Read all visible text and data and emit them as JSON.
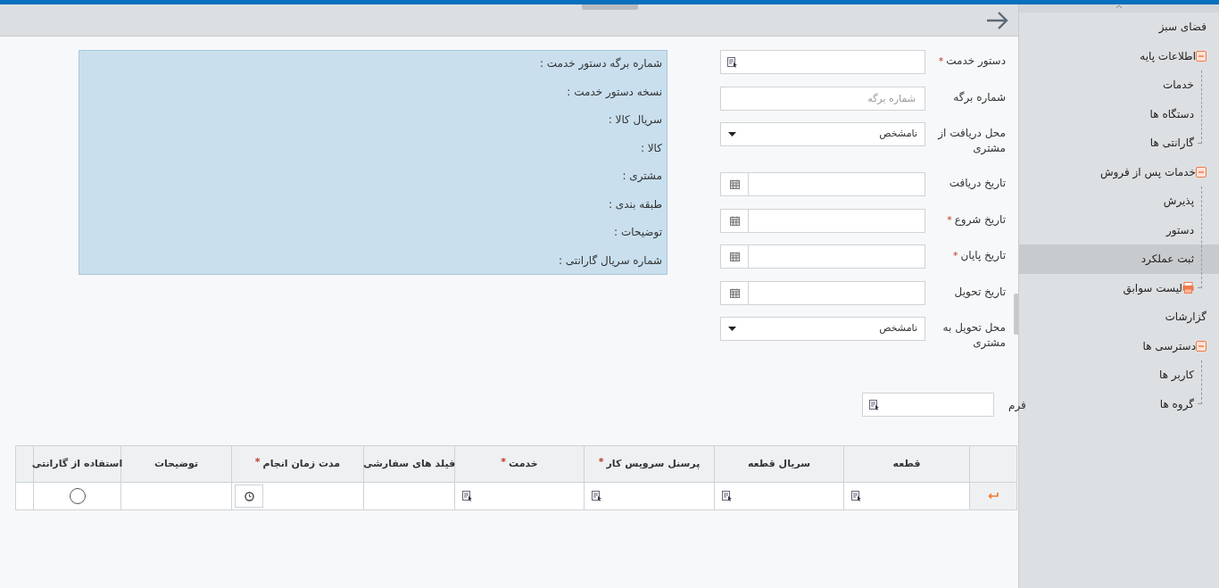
{
  "form": {
    "fields": [
      {
        "label": "دستور خدمت",
        "required_mark": "*",
        "kind": "lookup"
      },
      {
        "label": "شماره برگه",
        "kind": "text",
        "placeholder": "شماره برگه"
      },
      {
        "label": "محل دریافت از مشتری",
        "kind": "select",
        "value": "نامشخص"
      },
      {
        "label": "تاریخ دریافت",
        "kind": "date"
      },
      {
        "label": "تاریخ شروع",
        "required_mark": "*",
        "kind": "date"
      },
      {
        "label": "تاریخ پایان",
        "required_mark": "*",
        "kind": "date"
      },
      {
        "label": "تاریخ تحویل",
        "kind": "date"
      },
      {
        "label": "محل تحویل به مشتری",
        "kind": "select",
        "value": "نامشخص"
      }
    ],
    "form_field": {
      "label": "فرم",
      "kind": "lookup"
    }
  },
  "info_panel": [
    "شماره برگه دستور خدمت :",
    "نسخه دستور خدمت :",
    "سریال کالا :",
    "کالا :",
    "مشتری :",
    "طبقه بندی :",
    "توضیحات :",
    "شماره سریال گارانتی :"
  ],
  "table": {
    "columns": [
      {
        "label": "قطعه"
      },
      {
        "label": "سریال قطعه"
      },
      {
        "label": "پرسنل سرویس کار",
        "required_mark": "*"
      },
      {
        "label": "خدمت",
        "required_mark": "*"
      },
      {
        "label": "فیلد های سفارشی"
      },
      {
        "label": "مدت زمان انجام",
        "required_mark": "*"
      },
      {
        "label": "توضیحات"
      },
      {
        "label": "استفاده از گارانتی"
      }
    ],
    "rows": [
      {
        "cells": [
          {
            "kind": "lookup"
          },
          {
            "kind": "lookup"
          },
          {
            "kind": "lookup"
          },
          {
            "kind": "lookup"
          },
          {
            "kind": "empty"
          },
          {
            "kind": "time"
          },
          {
            "kind": "empty"
          },
          {
            "kind": "radio",
            "selected": false
          }
        ]
      }
    ]
  },
  "sidebar": {
    "items": [
      {
        "label": "فضای سبز",
        "selected": false
      },
      {
        "label": "اطلاعات پایه",
        "selected": false,
        "expanded": true,
        "children": [
          {
            "label": "خدمات",
            "selected": false
          },
          {
            "label": "دستگاه ها",
            "selected": false
          },
          {
            "label": "گارانتی ها",
            "selected": false
          }
        ]
      },
      {
        "label": "خدمات پس از فروش",
        "selected": false,
        "expanded": true,
        "children": [
          {
            "label": "پذیرش",
            "selected": false
          },
          {
            "label": "دستور",
            "selected": false
          },
          {
            "label": "ثبت عملکرد",
            "selected": true
          },
          {
            "label": "لیست سوابق",
            "selected": false,
            "kind": "printable"
          }
        ]
      },
      {
        "label": "گزارشات",
        "selected": false
      },
      {
        "label": "دسترسی ها",
        "selected": false,
        "expanded": true,
        "children": [
          {
            "label": "کاربر ها",
            "selected": false
          },
          {
            "label": "گروه ها",
            "selected": false
          }
        ]
      }
    ]
  }
}
